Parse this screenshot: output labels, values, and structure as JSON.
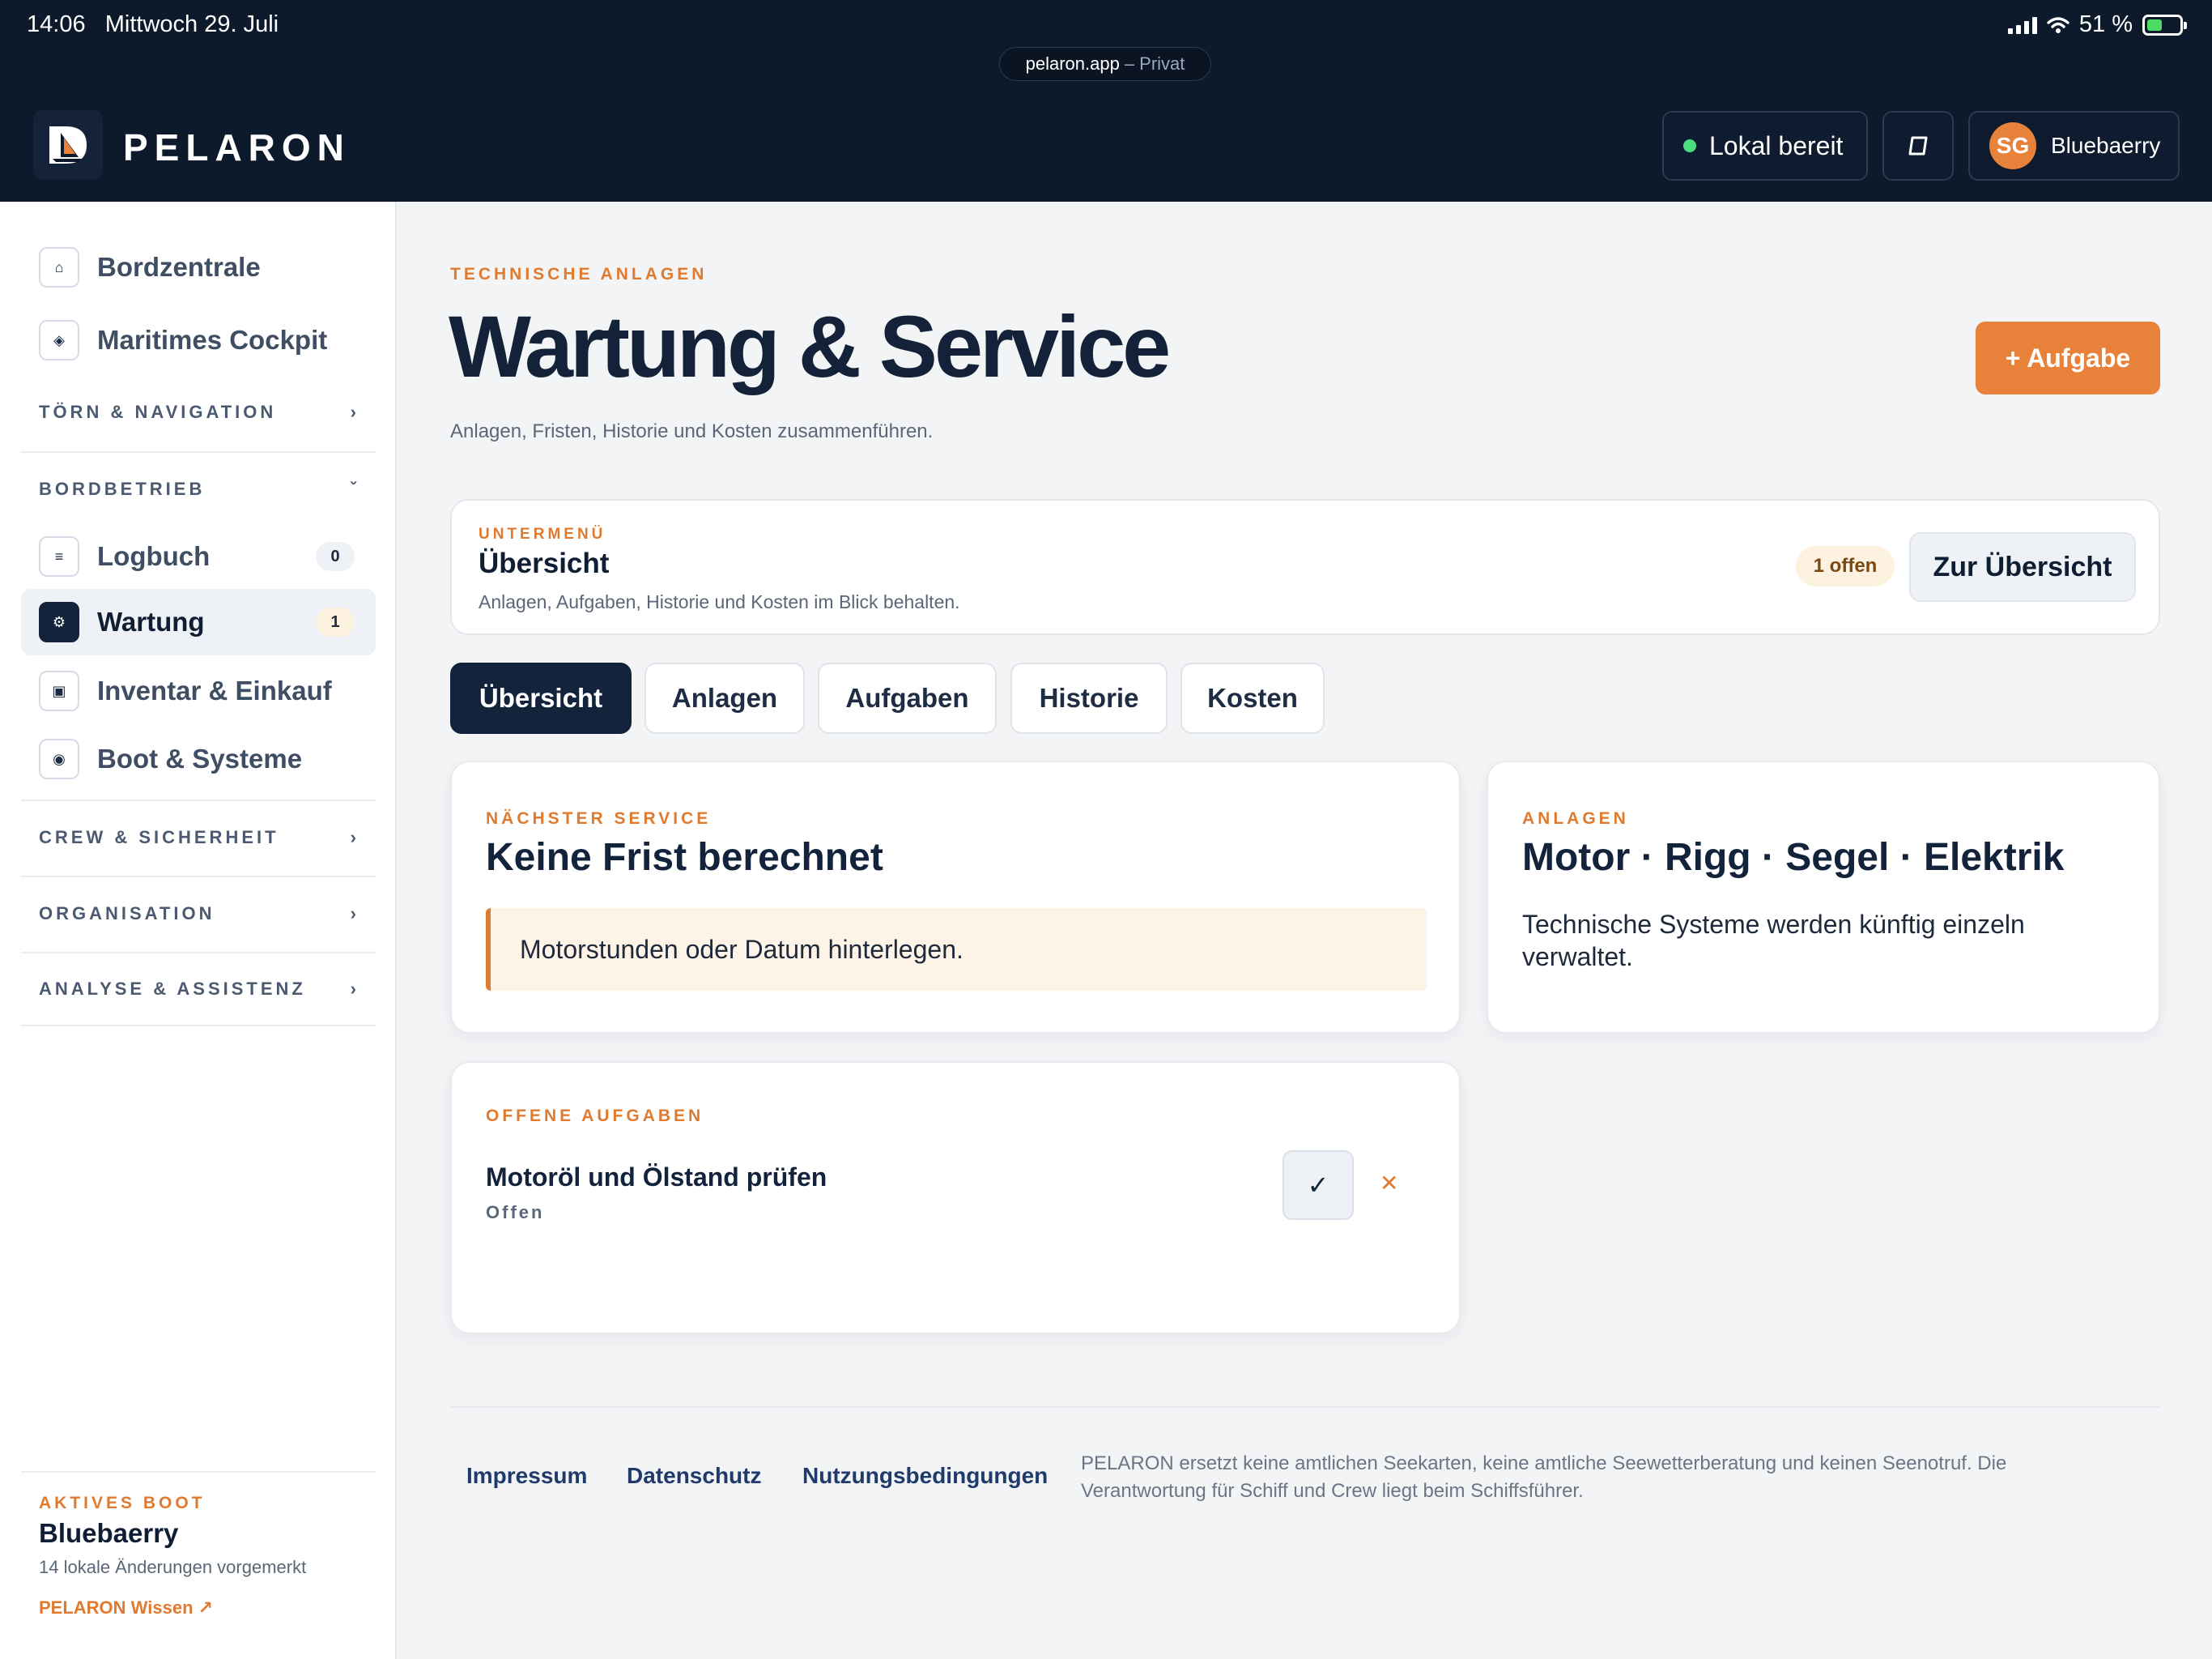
{
  "status_bar": {
    "time": "14:06",
    "date": "Mittwoch 29. Juli",
    "battery": "51 %",
    "url": "pelaron.app",
    "url_suffix": "– Privat"
  },
  "header": {
    "brand": "PELARON",
    "status_label": "Lokal bereit",
    "user_initials": "SG",
    "user_name": "Bluebaerry",
    "colors": {
      "background": "#0d1a2c",
      "accent": "#e8823a",
      "status_dot": "#4ade80"
    }
  },
  "sidebar": {
    "items_top": [
      {
        "label": "Bordzentrale",
        "icon": "home-icon"
      },
      {
        "label": "Maritimes Cockpit",
        "icon": "compass-icon"
      }
    ],
    "group_toern": "TÖRN & NAVIGATION",
    "group_bordbetrieb": "BORDBETRIEB",
    "items_bordbetrieb": [
      {
        "label": "Logbuch",
        "badge": "0",
        "icon": "list-icon"
      },
      {
        "label": "Wartung",
        "badge": "1",
        "icon": "gear-icon",
        "active": true
      },
      {
        "label": "Inventar & Einkauf",
        "icon": "box-icon"
      },
      {
        "label": "Boot & Systeme",
        "icon": "target-icon"
      }
    ],
    "group_crew": "CREW & SICHERHEIT",
    "group_org": "ORGANISATION",
    "group_analyse": "ANALYSE & ASSISTENZ",
    "footer": {
      "eyebrow": "AKTIVES BOOT",
      "boat": "Bluebaerry",
      "changes": "14 lokale Änderungen vorgemerkt",
      "link": "PELARON Wissen ↗"
    }
  },
  "main": {
    "eyebrow": "TECHNISCHE ANLAGEN",
    "title": "Wartung & Service",
    "subtitle": "Anlagen, Fristen, Historie und Kosten zusammenführen.",
    "add_button": "+ Aufgabe",
    "submenu": {
      "eyebrow": "UNTERMENÜ",
      "title": "Übersicht",
      "desc": "Anlagen, Aufgaben, Historie und Kosten im Blick behalten.",
      "open_badge": "1 offen",
      "button": "Zur Übersicht"
    },
    "tabs": [
      "Übersicht",
      "Anlagen",
      "Aufgaben",
      "Historie",
      "Kosten"
    ],
    "next_service": {
      "eyebrow": "NÄCHSTER SERVICE",
      "title": "Keine Frist berechnet",
      "notice": "Motorstunden oder Datum hinterlegen."
    },
    "assets": {
      "eyebrow": "ANLAGEN",
      "title": "Motor · Rigg · Segel · Elektrik",
      "text": "Technische Systeme werden künftig einzeln verwaltet."
    },
    "open_tasks": {
      "eyebrow": "OFFENE AUFGABEN",
      "task_title": "Motoröl und Ölstand prüfen",
      "task_status": "Offen"
    }
  },
  "footer": {
    "links": [
      "Impressum",
      "Datenschutz",
      "Nutzungsbedingungen"
    ],
    "note": "PELARON ersetzt keine amtlichen Seekarten, keine amtliche Seewetterberatung und keinen Seenotruf. Die Verantwortung für Schiff und Crew liegt beim Schiffsführer."
  }
}
